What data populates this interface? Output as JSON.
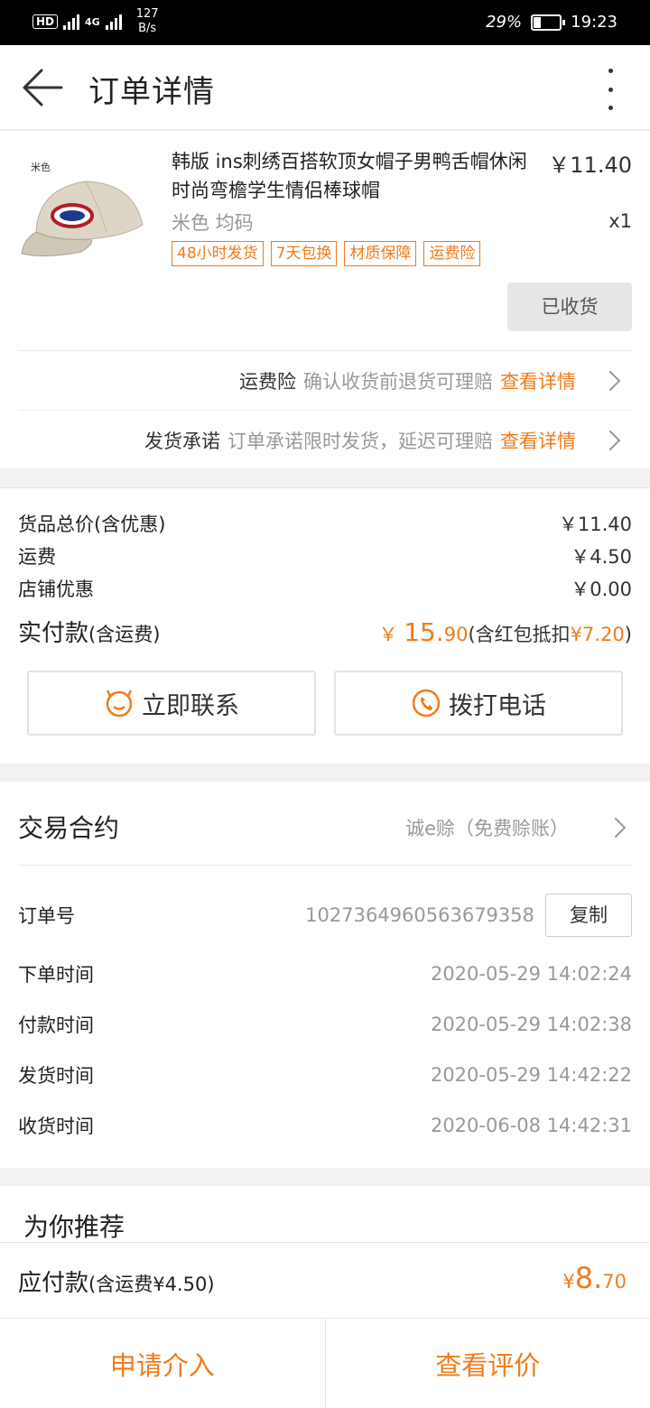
{
  "status_bar": {
    "network_speed": "127",
    "speed_unit": "B/s",
    "network_type": "4G",
    "hd": "HD",
    "battery_percent": "29%",
    "battery_level": 0.29,
    "time": "19:23"
  },
  "header": {
    "title": "订单详情"
  },
  "product": {
    "image_label": "米色",
    "name": "韩版 ins刺绣百搭软顶女帽子男鸭舌帽休闲时尚弯檐学生情侣棒球帽",
    "price": "￥11.40",
    "sku": "米色 均码",
    "quantity": "x1",
    "tags": [
      "48小时发货",
      "7天包换",
      "材质保障",
      "运费险"
    ],
    "received_button": "已收货"
  },
  "services": [
    {
      "label": "运费险",
      "desc": "确认收货前退货可理赔",
      "link": "查看详情"
    },
    {
      "label": "发货承诺",
      "desc": "订单承诺限时发货，延迟可理赔",
      "link": "查看详情"
    }
  ],
  "price_summary": {
    "rows": [
      {
        "label": "货品总价(含优惠)",
        "value": "￥11.40"
      },
      {
        "label": "运费",
        "value": "￥4.50"
      },
      {
        "label": "店铺优惠",
        "value": "￥0.00"
      }
    ],
    "actual_label": "实付款",
    "actual_label_note": "(含运费)",
    "actual_currency": "￥",
    "actual_int": "15.",
    "actual_dec": "90",
    "actual_note_prefix": "(含红包抵扣",
    "actual_note_amount": "¥7.20",
    "actual_note_suffix": ")"
  },
  "actions": {
    "contact": "立即联系",
    "call": "拨打电话"
  },
  "contract": {
    "title": "交易合约",
    "value": "诚e赊（免费赊账）"
  },
  "order_info": {
    "order_no_label": "订单号",
    "order_no": "1027364960563679358",
    "copy_button": "复制",
    "rows": [
      {
        "label": "下单时间",
        "value": "2020-05-29 14:02:24"
      },
      {
        "label": "付款时间",
        "value": "2020-05-29 14:02:38"
      },
      {
        "label": "发货时间",
        "value": "2020-05-29 14:42:22"
      },
      {
        "label": "收货时间",
        "value": "2020-06-08 14:42:31"
      }
    ]
  },
  "recommend": {
    "title": "为你推荐"
  },
  "payable": {
    "label": "应付款",
    "note": "(含运费¥4.50)",
    "currency": "¥",
    "int": "8.",
    "dec": "70"
  },
  "bottom_buttons": {
    "left": "申请介入",
    "right": "查看评价"
  },
  "colors": {
    "accent": "#f07b1a",
    "muted": "#999999",
    "background": "#f2f2f2"
  }
}
